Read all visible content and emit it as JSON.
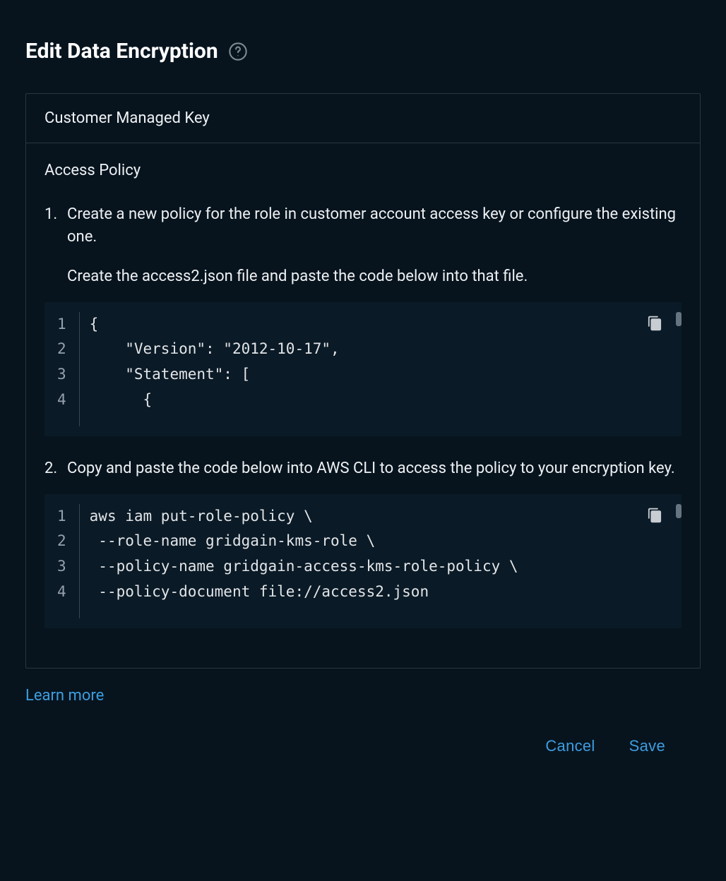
{
  "header": {
    "title": "Edit Data Encryption"
  },
  "panel": {
    "header": "Customer Managed Key",
    "subtitle": "Access Policy"
  },
  "steps": [
    {
      "text": "Create a new policy for the role in customer account access key or configure the existing one.",
      "subtext": "Create the access2.json file and paste the code below into that file.",
      "code_lines": [
        "{",
        "    \"Version\": \"2012-10-17\",",
        "    \"Statement\": [",
        "      {"
      ],
      "line_numbers": [
        "1",
        "2",
        "3",
        "4"
      ]
    },
    {
      "text": "Copy and paste the code below into AWS CLI to access the policy to your encryption key.",
      "code_lines": [
        "aws iam put-role-policy \\",
        " --role-name gridgain-kms-role \\",
        " --policy-name gridgain-access-kms-role-policy \\",
        " --policy-document file://access2.json"
      ],
      "line_numbers": [
        "1",
        "2",
        "3",
        "4"
      ]
    }
  ],
  "links": {
    "learn_more": "Learn more"
  },
  "footer": {
    "cancel": "Cancel",
    "save": "Save"
  }
}
